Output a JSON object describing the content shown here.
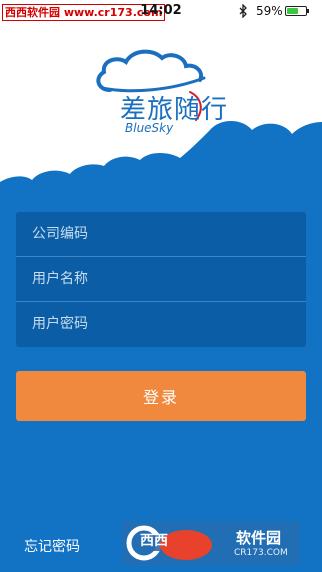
{
  "status_bar": {
    "site_watermark": "西西软件园 www.cr173.com",
    "time": "14:02",
    "battery_percent": "59%",
    "battery_level": 0.59,
    "icons": [
      "bluetooth-icon",
      "battery-icon"
    ]
  },
  "header": {
    "app_name": "差旅随行",
    "brand": "BlueSky",
    "logo_icon": "cloud-icon"
  },
  "form": {
    "company_placeholder": "公司编码",
    "username_placeholder": "用户名称",
    "password_placeholder": "用户密码"
  },
  "actions": {
    "login_label": "登录",
    "forgot_password_label": "忘记密码"
  },
  "watermark": {
    "cr_text": "西西",
    "title": "软件园",
    "url": "CR173.COM"
  },
  "colors": {
    "primary_blue": "#1272c4",
    "field_blue": "#0b5ea6",
    "button_orange": "#f0893e",
    "header_white": "#ffffff"
  }
}
